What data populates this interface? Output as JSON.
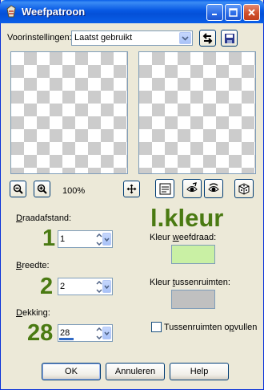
{
  "window": {
    "title": "Weefpatroon"
  },
  "presets": {
    "label": "Voorinstellingen:",
    "value": "Laatst gebruikt"
  },
  "zoom": {
    "level": "100%"
  },
  "settings": {
    "spacing_label": "Draadafstand:",
    "spacing_value": "1",
    "spacing_overlay": "1",
    "width_label": "Breedte:",
    "width_value": "2",
    "width_overlay": "2",
    "opacity_label": "Dekking:",
    "opacity_value": "28",
    "opacity_overlay": "28",
    "opacity_bar_fraction": 0.28
  },
  "colors": {
    "overlay_label": "l.kleur",
    "thread_label": "Kleur weefdraad:",
    "thread_color": "#c9f0a4",
    "gap_label": "Kleur tussenruimten:",
    "gap_color": "#c0c0c0",
    "fill_gaps_label": "Tussenruimten opvullen",
    "fill_gaps_checked": false,
    "annotation_color": "#4a7a12"
  },
  "buttons": {
    "ok": "OK",
    "cancel": "Annuleren",
    "help": "Help"
  }
}
